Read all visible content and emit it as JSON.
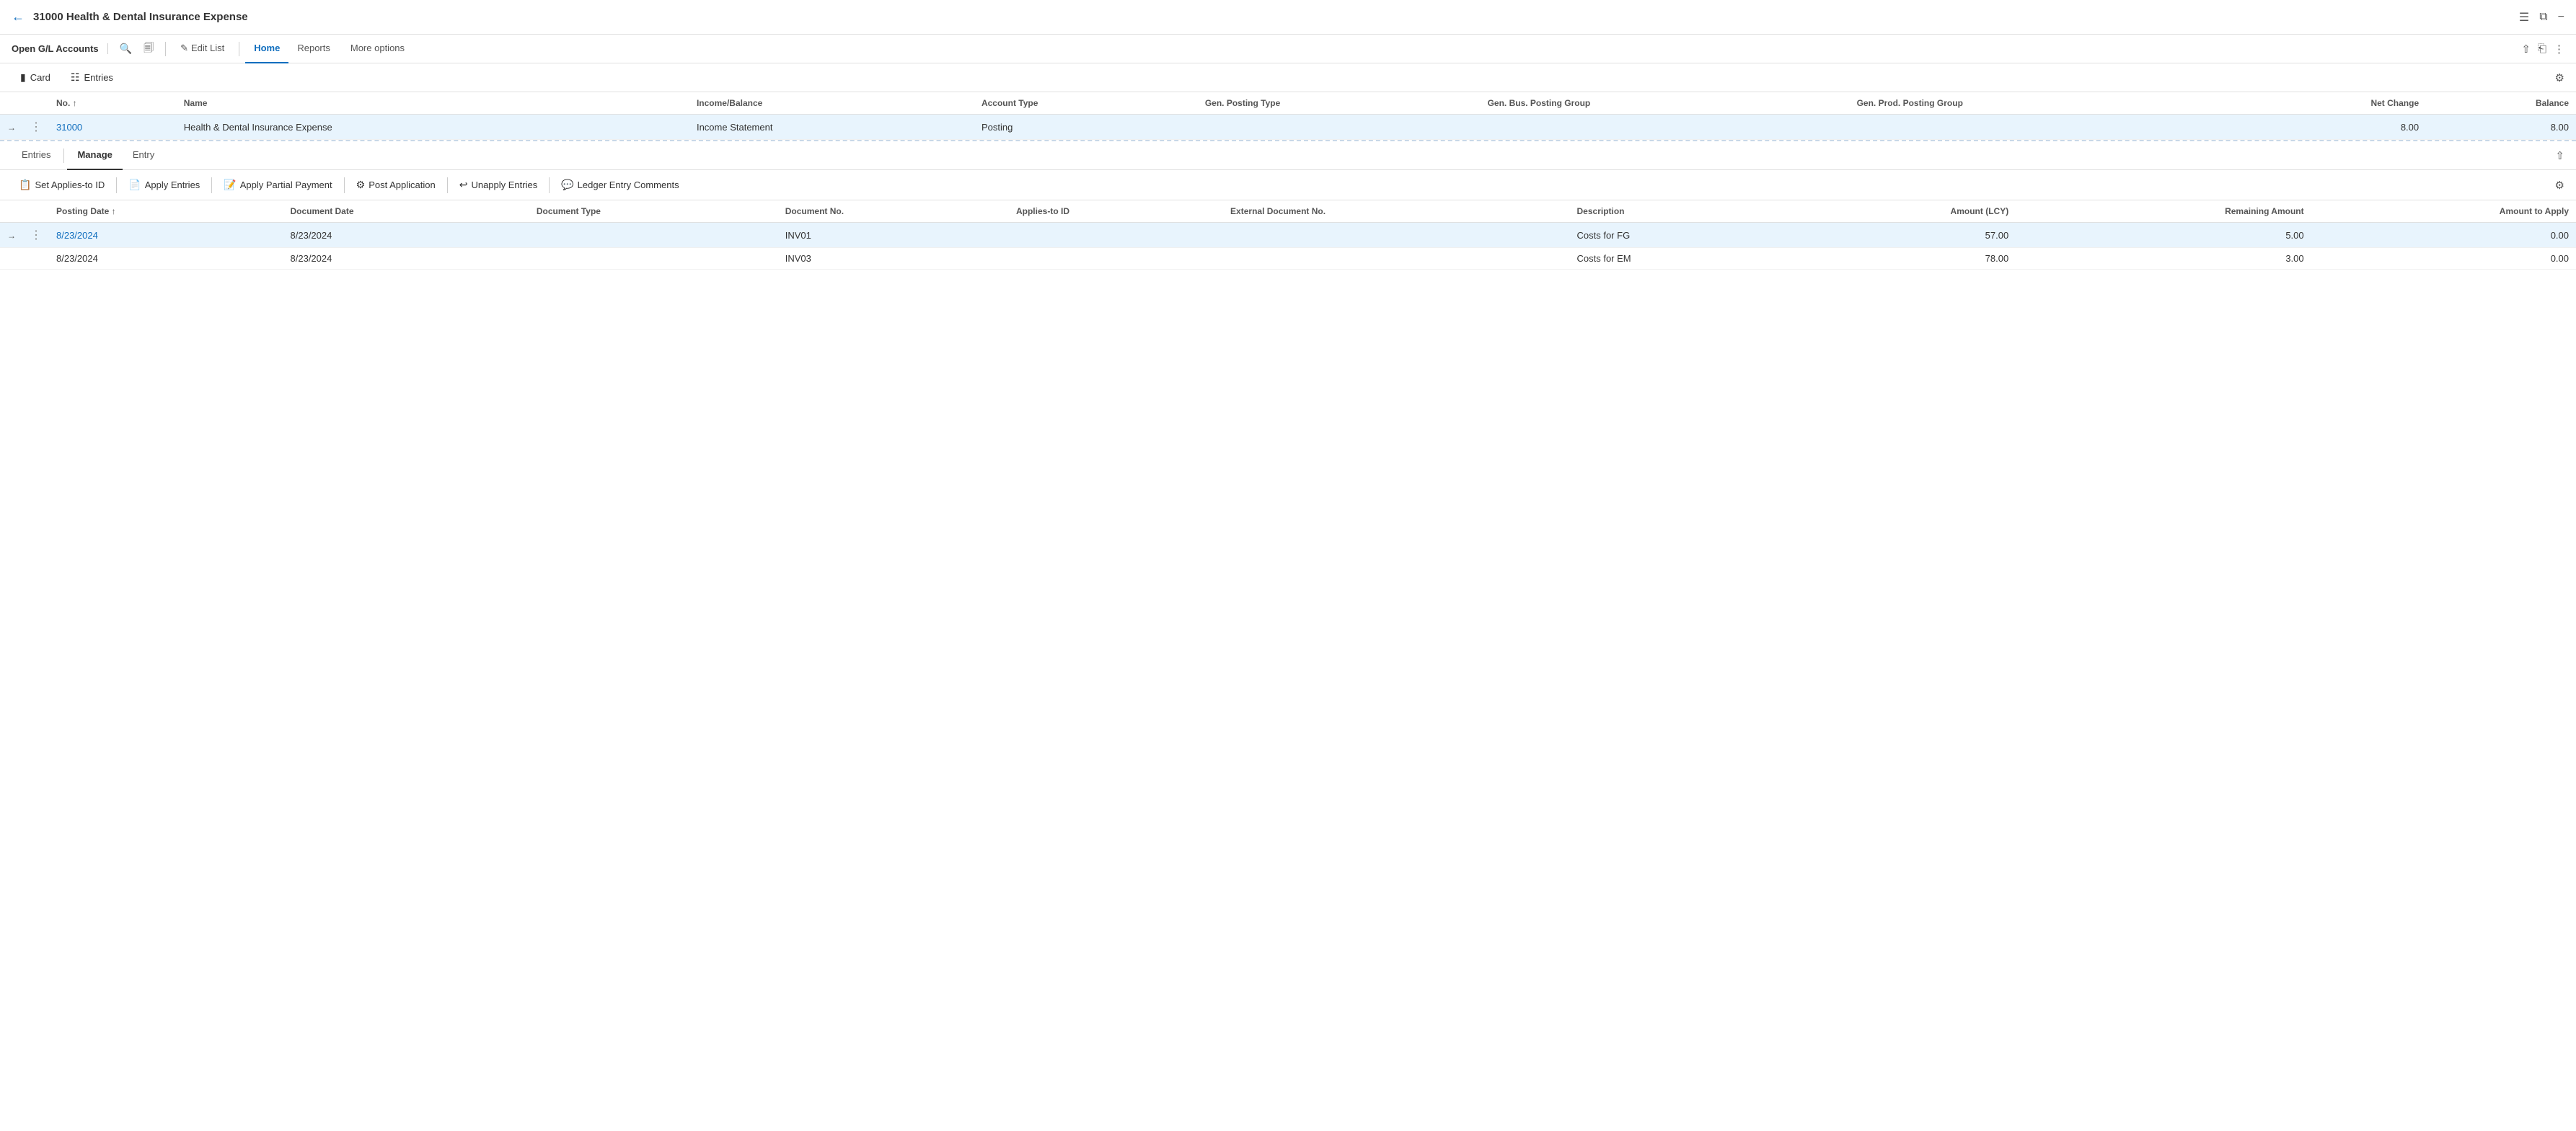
{
  "topBar": {
    "title": "31000 Health & Dental Insurance Expense",
    "backIcon": "←",
    "icons": [
      "bookmark-icon",
      "open-new-icon",
      "minimize-icon"
    ]
  },
  "navBar": {
    "sectionLabel": "Open G/L Accounts",
    "menus": [
      {
        "id": "home",
        "label": "Home",
        "active": true
      },
      {
        "id": "reports",
        "label": "Reports",
        "active": false
      }
    ],
    "moreOptions": "More options",
    "editList": "Edit List"
  },
  "actionBar": {
    "cardLabel": "Card",
    "entriesLabel": "Entries"
  },
  "upperTable": {
    "columns": [
      {
        "id": "no",
        "label": "No. ↑"
      },
      {
        "id": "name",
        "label": "Name"
      },
      {
        "id": "incomeBalance",
        "label": "Income/Balance"
      },
      {
        "id": "accountType",
        "label": "Account Type"
      },
      {
        "id": "genPostingType",
        "label": "Gen. Posting Type"
      },
      {
        "id": "genBusPostingGroup",
        "label": "Gen. Bus. Posting Group"
      },
      {
        "id": "genProdPostingGroup",
        "label": "Gen. Prod. Posting Group"
      },
      {
        "id": "netChange",
        "label": "Net Change"
      },
      {
        "id": "balance",
        "label": "Balance"
      }
    ],
    "rows": [
      {
        "no": "31000",
        "name": "Health & Dental Insurance Expense",
        "incomeBalance": "Income Statement",
        "accountType": "Posting",
        "genPostingType": "",
        "genBusPostingGroup": "",
        "genProdPostingGroup": "",
        "netChange": "8.00",
        "balance": "8.00",
        "selected": true
      }
    ]
  },
  "entriesTabs": [
    {
      "id": "entries",
      "label": "Entries",
      "active": false
    },
    {
      "id": "manage",
      "label": "Manage",
      "active": true
    },
    {
      "id": "entry",
      "label": "Entry",
      "active": false
    }
  ],
  "entriesActions": [
    {
      "id": "set-applies-to-id",
      "label": "Set Applies-to ID",
      "icon": "📋"
    },
    {
      "id": "apply-entries",
      "label": "Apply Entries",
      "icon": "📄"
    },
    {
      "id": "apply-partial-payment",
      "label": "Apply Partial Payment",
      "icon": "📝"
    },
    {
      "id": "post-application",
      "label": "Post Application",
      "icon": "⚙"
    },
    {
      "id": "unapply-entries",
      "label": "Unapply Entries",
      "icon": "↩"
    },
    {
      "id": "ledger-entry-comments",
      "label": "Ledger Entry Comments",
      "icon": "💬"
    }
  ],
  "lowerTable": {
    "columns": [
      {
        "id": "postingDate",
        "label": "Posting Date ↑"
      },
      {
        "id": "documentDate",
        "label": "Document Date"
      },
      {
        "id": "documentType",
        "label": "Document Type"
      },
      {
        "id": "documentNo",
        "label": "Document No."
      },
      {
        "id": "appliesToId",
        "label": "Applies-to ID"
      },
      {
        "id": "externalDocNo",
        "label": "External Document No."
      },
      {
        "id": "description",
        "label": "Description"
      },
      {
        "id": "amountLcy",
        "label": "Amount (LCY)"
      },
      {
        "id": "remainingAmount",
        "label": "Remaining Amount"
      },
      {
        "id": "amountToApply",
        "label": "Amount to Apply"
      }
    ],
    "rows": [
      {
        "postingDate": "8/23/2024",
        "documentDate": "8/23/2024",
        "documentType": "",
        "documentNo": "INV01",
        "appliesToId": "",
        "externalDocNo": "",
        "description": "Costs for FG",
        "amountLcy": "57.00",
        "remainingAmount": "5.00",
        "amountToApply": "0.00",
        "selected": true
      },
      {
        "postingDate": "8/23/2024",
        "documentDate": "8/23/2024",
        "documentType": "",
        "documentNo": "INV03",
        "appliesToId": "",
        "externalDocNo": "",
        "description": "Costs for EM",
        "amountLcy": "78.00",
        "remainingAmount": "3.00",
        "amountToApply": "0.00",
        "selected": false
      }
    ]
  }
}
